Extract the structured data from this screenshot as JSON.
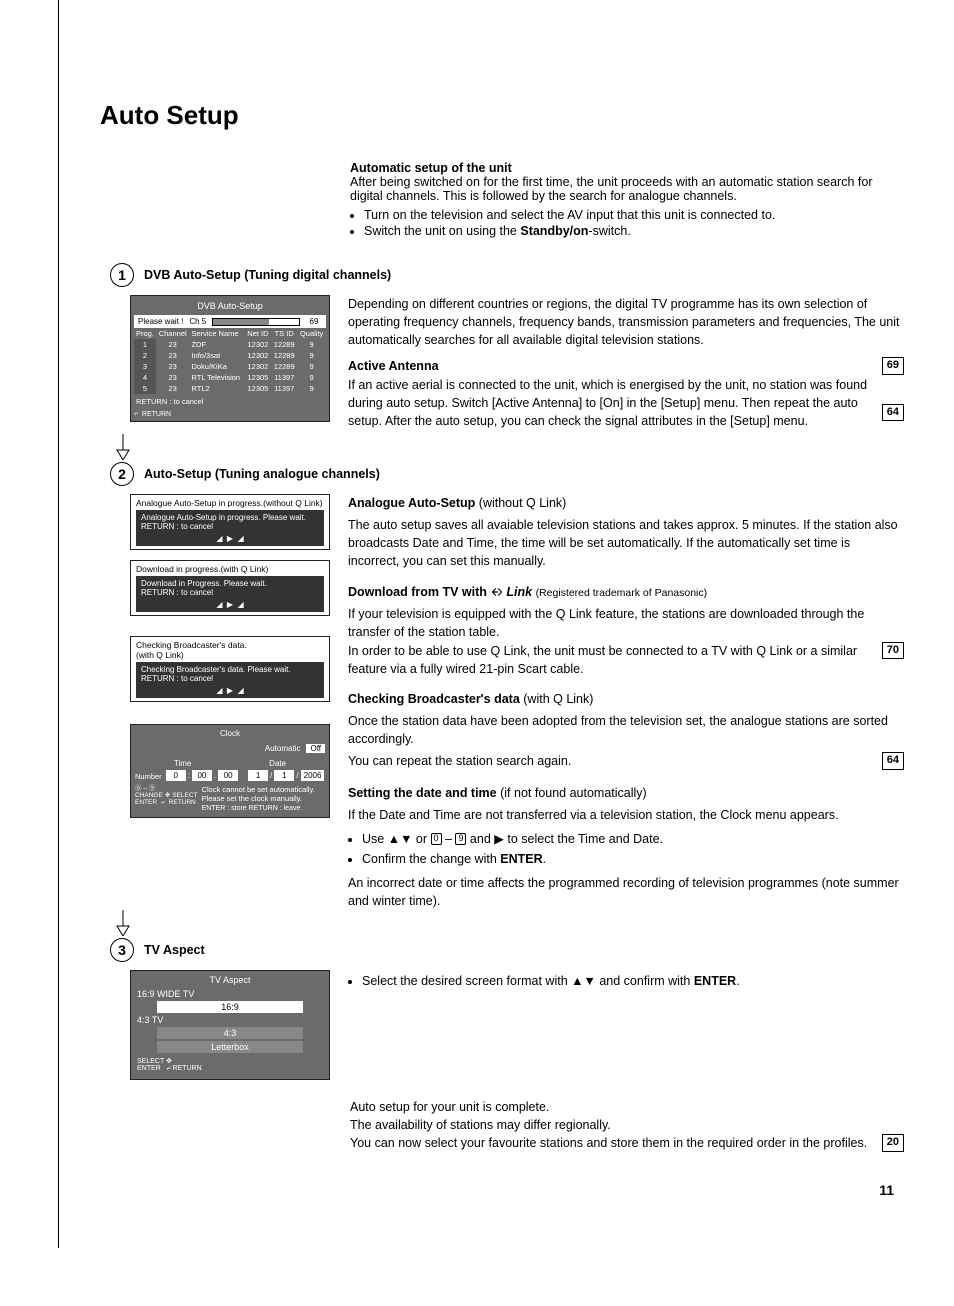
{
  "page": {
    "title": "Auto Setup",
    "number": "11"
  },
  "intro": {
    "heading": "Automatic setup of the unit",
    "body": "After being switched on for the first time, the unit proceeds with an automatic station search for digital channels. This is followed by the search for analogue channels.",
    "bullets": [
      "Turn on the television and select the AV input that this unit is connected to.",
      "Switch the unit on using the Standby/on-switch."
    ],
    "standby_label": "Standby/on"
  },
  "step1": {
    "num": "1",
    "title": "DVB Auto-Setup (Tuning digital channels)",
    "text1": "Depending on different countries or regions, the digital TV programme has its own selection of operating frequency channels, frequency bands, transmission parameters and frequencies, The unit automatically searches for all available digital television stations.",
    "sub_heading": "Active Antenna",
    "ref1": "69",
    "text2": "If an active aerial is connected to the unit, which is energised by the unit, no station was found during auto setup. Switch [Active Antenna] to [On] in the [Setup] menu. Then repeat the auto setup. After the auto setup, you can check the signal attributes in the [Setup] menu.",
    "ref2": "64",
    "osd": {
      "title": "DVB Auto-Setup",
      "wait": "Please wait !",
      "ch": "Ch 5",
      "q": "69",
      "headers": [
        "Prog.",
        "Channel",
        "Service Name",
        "Net ID",
        "TS ID",
        "Quality"
      ],
      "rows": [
        [
          "1",
          "23",
          "ZDF",
          "12302",
          "12289",
          "9"
        ],
        [
          "2",
          "23",
          "Info/3sat",
          "12302",
          "12289",
          "9"
        ],
        [
          "3",
          "23",
          "Doku/KiKa",
          "12302",
          "12289",
          "9"
        ],
        [
          "4",
          "23",
          "RTL Television",
          "12305",
          "11397",
          "9"
        ],
        [
          "5",
          "23",
          "RTL2",
          "12305",
          "11397",
          "9"
        ]
      ],
      "cancel": "RETURN : to cancel",
      "return": "RETURN"
    }
  },
  "step2": {
    "num": "2",
    "title": "Auto-Setup (Tuning analogue channels)",
    "osd_a_title": "Analogue Auto-Setup in progress.(without Q Link)",
    "osd_a_msg": "Analogue Auto-Setup in progress. Please wait.",
    "osd_a_cancel": "RETURN : to cancel",
    "osd_b_title": "Download in progress.(with Q Link)",
    "osd_b_msg": "Download in Progress. Please wait.",
    "osd_b_cancel": "RETURN : to cancel",
    "osd_c_title1": "Checking Broadcaster's data.",
    "osd_c_title2": "(with Q Link)",
    "osd_c_msg": "Checking Broadcaster's data. Please wait.",
    "osd_c_cancel": "RETURN : to cancel",
    "analogue_h": "Analogue Auto-Setup",
    "analogue_hq": " (without Q Link)",
    "analogue_t": "The auto setup saves all avaiable television stations and takes approx. 5 minutes. If the station also broadcasts Date and Time, the time will be set automatically. If the automatically set time is incorrect, you can set this manually.",
    "download_h": "Download from TV with",
    "download_tm": "(Registered trademark of Panasonic)",
    "download_t1": "If your television is equipped with the Q Link feature, the stations are downloaded through the transfer of the station table.",
    "download_t2": "In order to be able to use Q Link, the unit must be connected to a TV with Q Link or a similar feature via a fully wired 21-pin Scart cable.",
    "ref_70": "70",
    "check_h": "Checking Broadcaster's data",
    "check_hq": " (with Q Link)",
    "check_t1": "Once the station data have been adopted from the television set, the analogue stations are sorted accordingly.",
    "check_t2": "You can repeat the station search again.",
    "ref_64": "64",
    "clock": {
      "title": "Clock",
      "auto_label": "Automatic",
      "auto_val": "Off",
      "time_l": "Time",
      "date_l": "Date",
      "num_l": "Number",
      "h": "0",
      "m": "00",
      "s": "00",
      "d": "1",
      "mo": "1",
      "y": "2006",
      "msg1": "Clock cannot be set automatically.",
      "msg2": "Please set the clock manually.",
      "bot": "ENTER : store    RETURN : leave",
      "change": "CHANGE",
      "select": "SELECT",
      "enter": "ENTER",
      "return": "RETURN"
    },
    "set_h": "Setting the date and time",
    "set_hq": " (if not found automatically)",
    "set_t1": "If the Date and Time are not transferred via a television station, the Clock menu appears.",
    "set_b1a": "Use ",
    "set_b1b": " or ",
    "set_b1c": " – ",
    "set_b1d": " and ",
    "set_b1e": " to select the Time and Date.",
    "set_b2": "Confirm the change with ENTER.",
    "enter_word": "ENTER",
    "set_t2": "An incorrect date or time affects the programmed recording of television programmes (note summer and winter time)."
  },
  "step3": {
    "num": "3",
    "title": "TV Aspect",
    "osd": {
      "title": "TV Aspect",
      "l1": "16:9 WIDE TV",
      "o1": "16:9",
      "l2": "4:3 TV",
      "o2": "4:3",
      "o3": "Letterbox",
      "select": "SELECT",
      "enter": "ENTER",
      "return": "RETURN"
    },
    "bullet": "Select the desired screen format with ▲▼ and confirm with ENTER.",
    "bullet_pre": "Select the desired screen format with ",
    "bullet_post": " and confirm with ",
    "enter_word": "ENTER"
  },
  "conclusion": {
    "l1": "Auto setup for your unit is complete.",
    "l2": "The availability of stations may differ regionally.",
    "l3": "You can now select your favourite stations and store them in the required order in the profiles.",
    "ref": "20"
  }
}
